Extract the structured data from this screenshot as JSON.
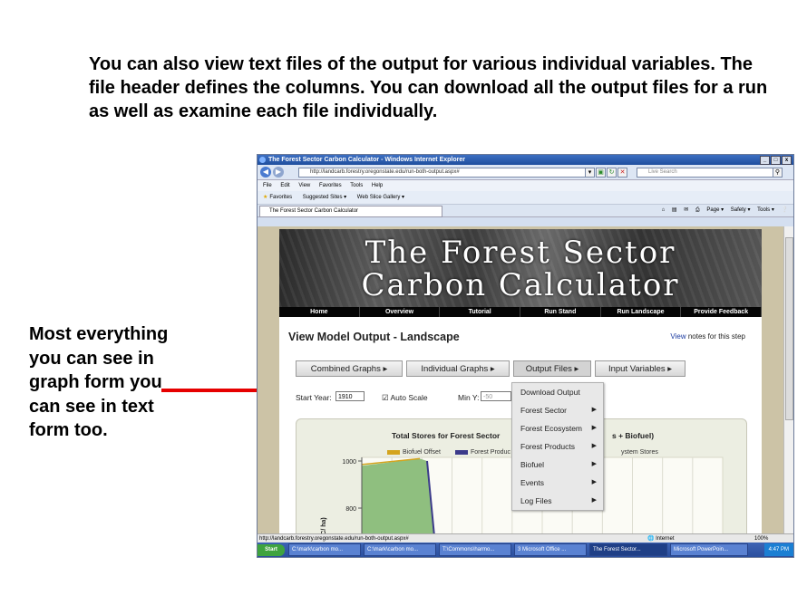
{
  "slide": {
    "intro_text": "You can also view text files of the output for various individual variables.  The file header defines the columns. You can download all the output files for a run as well as examine each file individually.",
    "side_note_text": "Most everything you can see in graph form you can see in text form too."
  },
  "browser": {
    "window_title": "The Forest Sector Carbon Calculator - Windows Internet Explorer",
    "window_buttons": [
      "_",
      "□",
      "x"
    ],
    "url": "http://landcarb.forestry.oregonstate.edu/run-both-output.aspx#",
    "search_placeholder": "Live Search",
    "menu_items": [
      "File",
      "Edit",
      "View",
      "Favorites",
      "Tools",
      "Help"
    ],
    "favorites_label": "Favorites",
    "suggested_sites": "Suggested Sites ▾",
    "web_slice": "Web Slice Gallery ▾",
    "tab_title": "The Forest Sector Carbon Calculator",
    "command_items": [
      "Page ▾",
      "Safety ▾",
      "Tools ▾"
    ],
    "status_url": "http://landcarb.forestry.oregonstate.edu/run-both-output.aspx#",
    "zone": "Internet",
    "zoom": "100%"
  },
  "site": {
    "banner_line1": "The Forest Sector",
    "banner_line2": "Carbon Calculator",
    "nav": [
      "Home",
      "Overview",
      "Tutorial",
      "Run Stand",
      "Run Landscape",
      "Provide Feedback"
    ]
  },
  "page": {
    "title": "View Model Output - Landscape",
    "view_link": "View",
    "view_rest": " notes for this step",
    "buttons": [
      "Combined Graphs  ▸",
      "Individual Graphs  ▸",
      "Output Files  ▸",
      "Input Variables  ▸"
    ],
    "start_year_label": "Start Year:",
    "start_year_value": "1910",
    "auto_scale_label": "Auto Scale",
    "min_y_label": "Min Y:",
    "min_y_value": "-50"
  },
  "dropdown": {
    "items": [
      {
        "label": "Download Output",
        "submenu": false
      },
      {
        "label": "Forest Sector",
        "submenu": true
      },
      {
        "label": "Forest Ecosystem",
        "submenu": true
      },
      {
        "label": "Forest Products",
        "submenu": true
      },
      {
        "label": "Biofuel",
        "submenu": true
      },
      {
        "label": "Events",
        "submenu": true
      },
      {
        "label": "Log Files",
        "submenu": true
      }
    ]
  },
  "chart_data": {
    "type": "area",
    "title_left": "Total Stores for Forest Sector",
    "title_right": "s + Biofuel)",
    "legend_left": [
      "Biofuel Offset",
      "Forest Produc"
    ],
    "legend_right": "ystem Stores",
    "colors": {
      "biofuel": "#d4a41e",
      "products": "#3b3a8a",
      "ecosystem": "#8fbf7f"
    },
    "yticks": [
      "1000",
      "800"
    ],
    "ylabel": "C/ ha)",
    "ylim": [
      600,
      1000
    ]
  },
  "taskbar": {
    "start": "Start",
    "tasks": [
      "C:\\mark\\carbon mo...",
      "C:\\mark\\carbon mo...",
      "T:\\Commons\\harmo...",
      "3 Microsoft Office ...",
      "The Forest Sector...",
      "Microsoft PowerPoin..."
    ],
    "clock": "4:47 PM"
  }
}
